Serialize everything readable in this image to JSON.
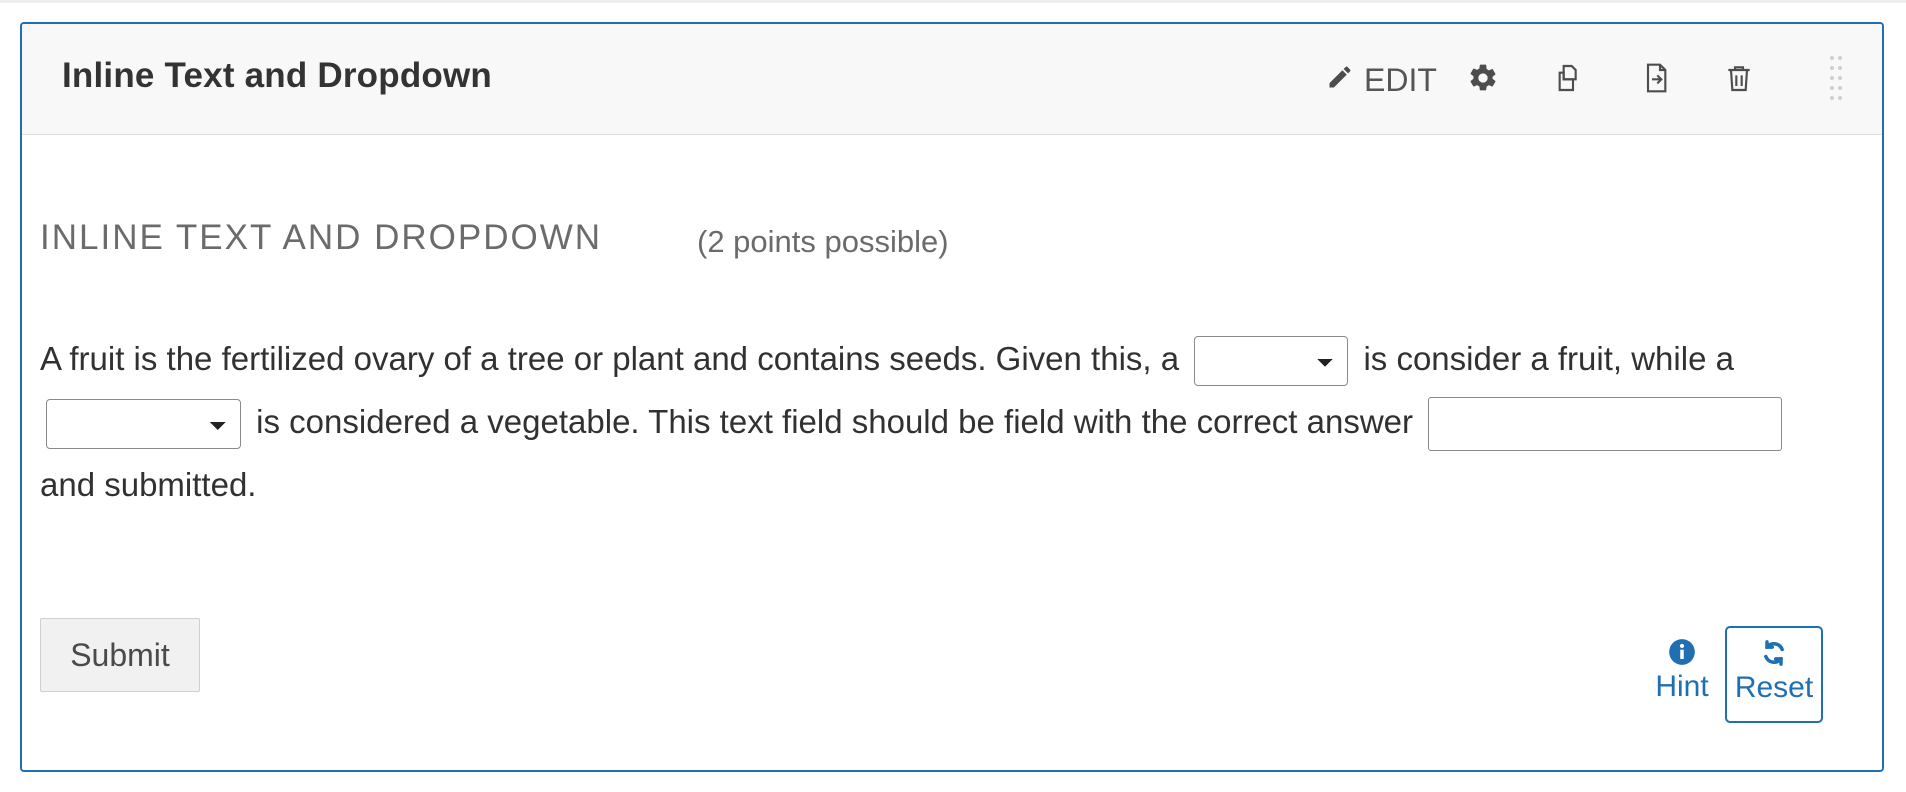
{
  "header": {
    "title": "Inline Text and Dropdown",
    "edit_label": "EDIT"
  },
  "problem": {
    "heading": "INLINE TEXT AND DROPDOWN",
    "points": "(2 points possible)",
    "text_1": "A fruit is the fertilized ovary of a tree or plant and contains seeds. Given this, a",
    "text_2": "is consider a fruit, while a",
    "text_3": "is considered a vegetable. This text field should be field with the correct answer",
    "text_4": "and submitted.",
    "dropdown_1_value": "",
    "dropdown_2_value": "",
    "text_input_value": ""
  },
  "buttons": {
    "submit_label": "Submit",
    "hint_label": "Hint",
    "reset_label": "Reset"
  },
  "colors": {
    "accent": "#1f6fb2",
    "header_bg": "#f8f8f8"
  },
  "icons": [
    "pencil-icon",
    "gear-icon",
    "duplicate-icon",
    "move-icon",
    "trash-icon",
    "drag-handle-icon",
    "info-icon",
    "refresh-icon"
  ]
}
